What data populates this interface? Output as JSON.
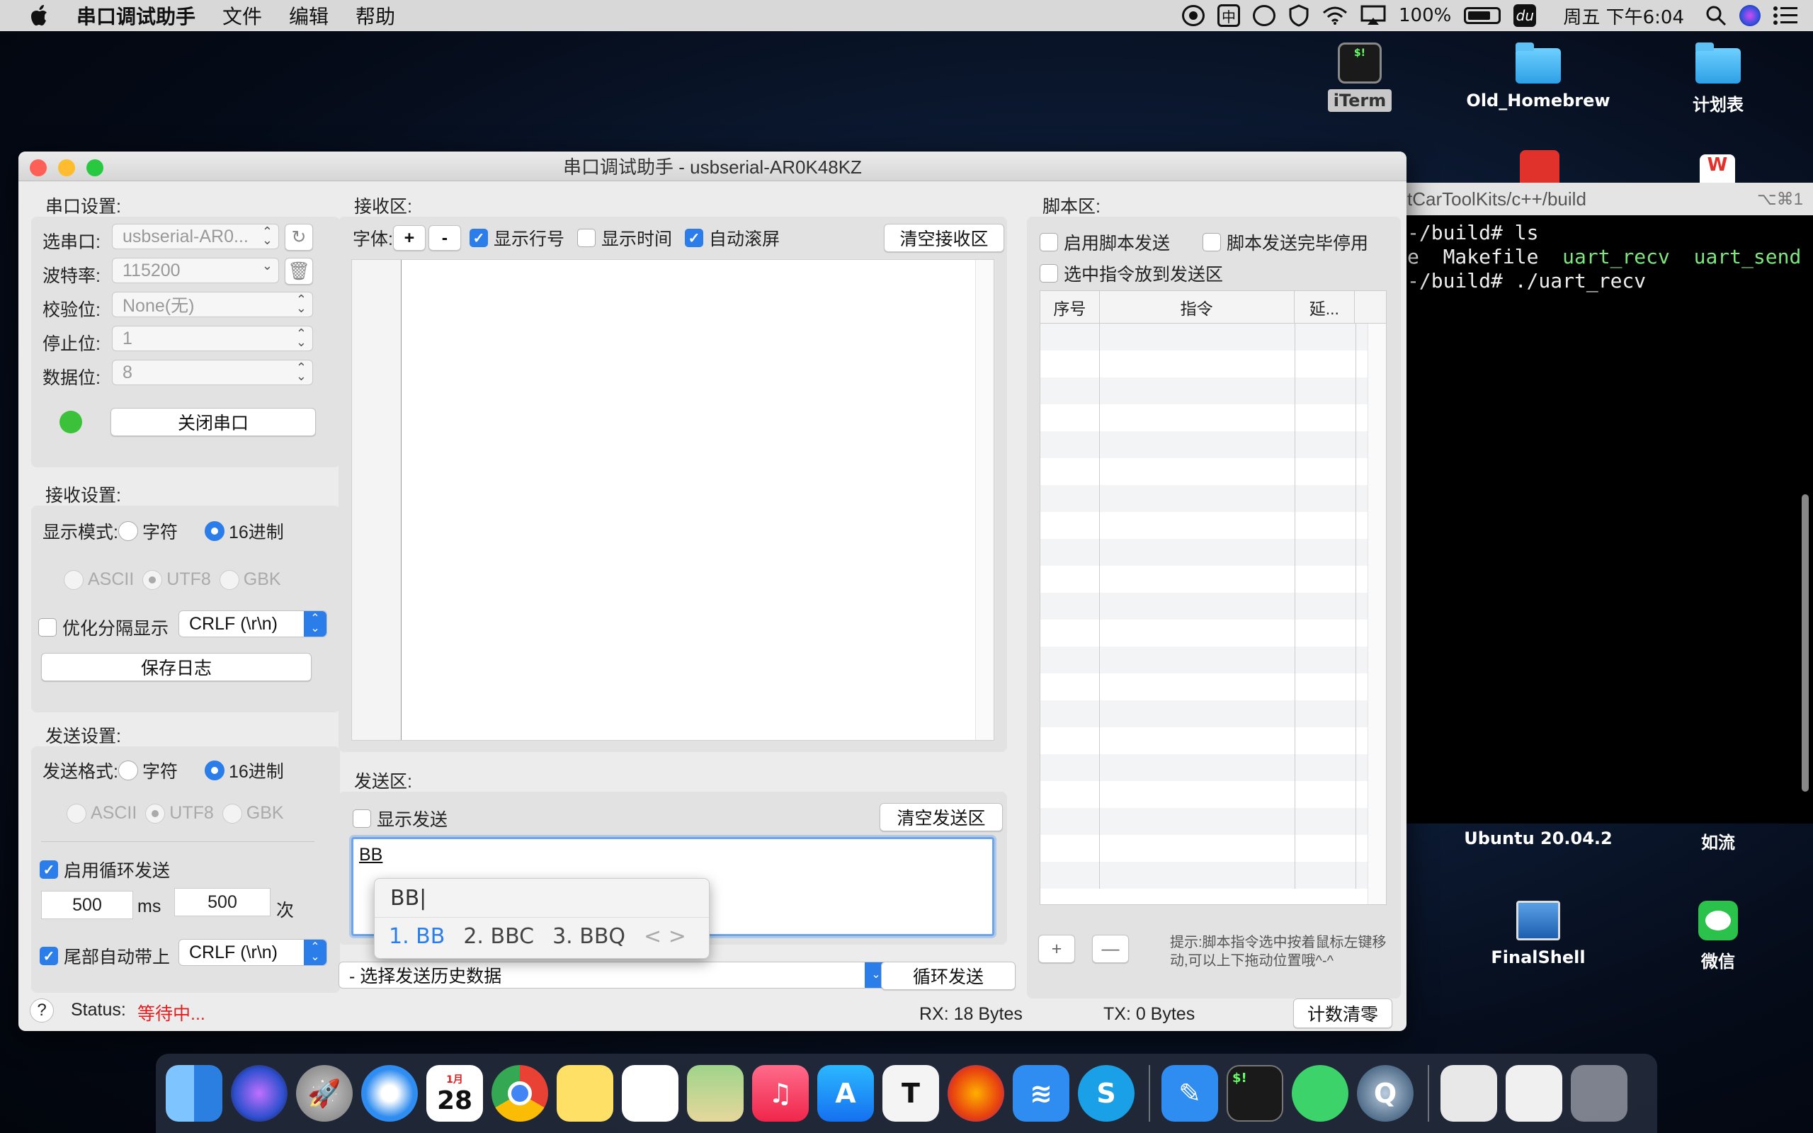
{
  "menubar": {
    "app_name": "串口调试助手",
    "items": [
      "文件",
      "编辑",
      "帮助"
    ],
    "battery": "100%",
    "ime": "中",
    "du": "du",
    "clock": "周五 下午6:04"
  },
  "desktop": {
    "iterm_label": "iTerm",
    "folder1_label": "Old_Homebrew",
    "folder2_label": "计划表",
    "ubuntu_label": "Ubuntu 20.04.2",
    "ruliu_label": "如流",
    "finalshell_label": "FinalShell",
    "wechat_label": "微信"
  },
  "terminal": {
    "title": "tCarToolKits/c++/build",
    "shortcut": "⌥⌘1",
    "line1": "-/build# ls",
    "line2_a": "e  Makefile  ",
    "line2_b": "uart_recv",
    "line2_c": "  ",
    "line2_d": "uart_send",
    "line3": "-/build# ./uart_recv"
  },
  "window": {
    "title": "串口调试助手 - usbserial-AR0K48KZ"
  },
  "serial": {
    "group_label": "串口设置:",
    "port_label": "选串口:",
    "port_value": "usbserial-AR0...",
    "baud_label": "波特率:",
    "baud_value": "115200",
    "parity_label": "校验位:",
    "parity_value": "None(无)",
    "stop_label": "停止位:",
    "stop_value": "1",
    "data_label": "数据位:",
    "data_value": "8",
    "close_button": "关闭串口"
  },
  "receive_settings": {
    "group_label": "接收设置:",
    "mode_label": "显示模式:",
    "char_label": "字符",
    "hex_label": "16进制",
    "ascii_label": "ASCII",
    "utf8_label": "UTF8",
    "gbk_label": "GBK",
    "optimize_label": "优化分隔显示",
    "crlf_value": "CRLF (\\r\\n)",
    "save_log_button": "保存日志"
  },
  "send_settings": {
    "group_label": "发送设置:",
    "format_label": "发送格式:",
    "char_label": "字符",
    "hex_label": "16进制",
    "ascii_label": "ASCII",
    "utf8_label": "UTF8",
    "gbk_label": "GBK",
    "loop_label": "启用循环发送",
    "interval_value": "500",
    "ms_label": "ms",
    "count_value": "500",
    "times_label": "次",
    "tail_label": "尾部自动带上",
    "tail_value": "CRLF (\\r\\n)"
  },
  "receive_area": {
    "group_label": "接收区:",
    "font_label": "字体:",
    "plus": "+",
    "minus": "-",
    "line_numbers_label": "显示行号",
    "show_time_label": "显示时间",
    "auto_scroll_label": "自动滚屏",
    "clear_button": "清空接收区"
  },
  "send_area": {
    "group_label": "发送区:",
    "show_send_label": "显示发送",
    "clear_button": "清空发送区",
    "input_value": "BB",
    "history_placeholder": "- 选择发送历史数据",
    "loop_send_button": "循环发送"
  },
  "ime_popup": {
    "preedit": "BB|",
    "candidates": [
      "1. BB",
      "2. BBC",
      "3. BBQ"
    ],
    "nav": "< >"
  },
  "script_area": {
    "group_label": "脚本区:",
    "enable_label": "启用脚本发送",
    "stop_after_label": "脚本发送完毕停用",
    "put_selected_label": "选中指令放到发送区",
    "col_index": "序号",
    "col_command": "指令",
    "col_delay": "延...",
    "add": "+",
    "remove": "—",
    "hint": "提示:脚本指令选中按着鼠标左键移动,可以上下拖动位置哦^-^"
  },
  "status": {
    "help": "?",
    "label": "Status:",
    "value": "等待中...",
    "rx": "RX:  18 Bytes",
    "tx": "TX: 0 Bytes",
    "reset_button": "计数清零"
  },
  "dock": {
    "calendar_month": "1月",
    "calendar_day": "28",
    "typora": "T"
  },
  "colors": {
    "accent": "#2b7de9",
    "status_waiting": "#e02020",
    "led_green": "#3cc13b"
  }
}
